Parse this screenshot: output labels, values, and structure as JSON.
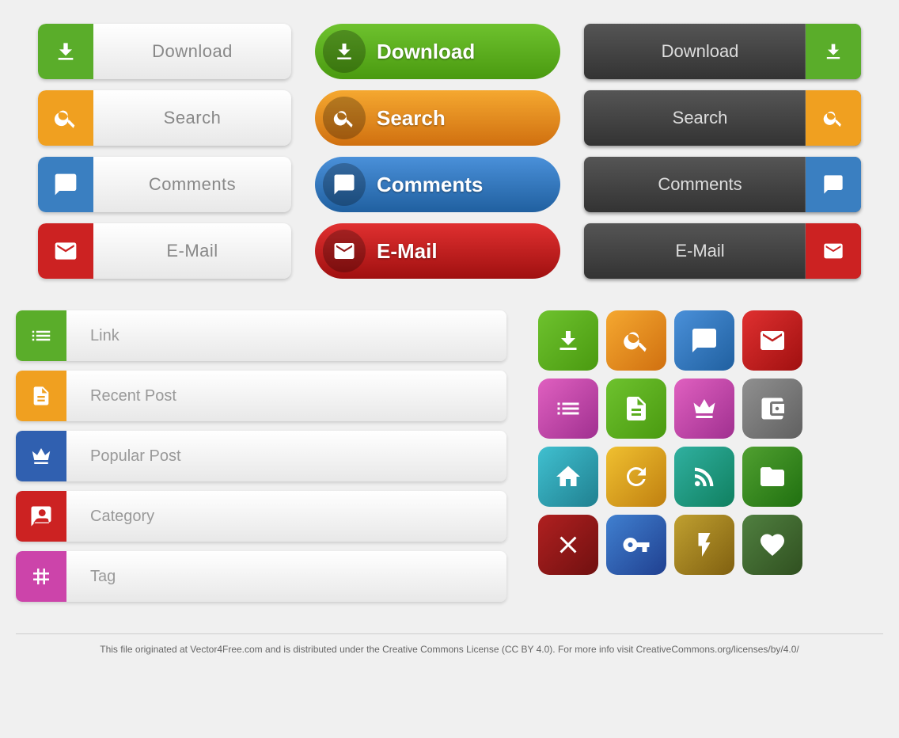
{
  "col1": {
    "buttons": [
      {
        "label": "Download",
        "color": "green",
        "icon": "download"
      },
      {
        "label": "Search",
        "color": "orange",
        "icon": "search"
      },
      {
        "label": "Comments",
        "color": "blue",
        "icon": "comment"
      },
      {
        "label": "E-Mail",
        "color": "red",
        "icon": "email"
      }
    ]
  },
  "col2": {
    "buttons": [
      {
        "label": "Download",
        "color": "green",
        "icon": "download"
      },
      {
        "label": "Search",
        "color": "orange",
        "icon": "search"
      },
      {
        "label": "Comments",
        "color": "blue",
        "icon": "comment"
      },
      {
        "label": "E-Mail",
        "color": "red",
        "icon": "email"
      }
    ]
  },
  "col3": {
    "buttons": [
      {
        "label": "Download",
        "color": "green",
        "icon": "download"
      },
      {
        "label": "Search",
        "color": "orange",
        "icon": "search"
      },
      {
        "label": "Comments",
        "color": "blue",
        "icon": "comment"
      },
      {
        "label": "E-Mail",
        "color": "red",
        "icon": "email"
      }
    ]
  },
  "list": {
    "items": [
      {
        "label": "Link",
        "color": "green",
        "icon": "list"
      },
      {
        "label": "Recent Post",
        "color": "orange",
        "icon": "doc"
      },
      {
        "label": "Popular Post",
        "color": "blue-royal",
        "icon": "crown"
      },
      {
        "label": "Category",
        "color": "red",
        "icon": "category"
      },
      {
        "label": "Tag",
        "color": "pink",
        "icon": "tag"
      }
    ]
  },
  "grid": {
    "icons": [
      {
        "name": "download",
        "color": "ic-green-d"
      },
      {
        "name": "search",
        "color": "ic-orange-s"
      },
      {
        "name": "comment",
        "color": "ic-blue-c"
      },
      {
        "name": "email",
        "color": "ic-red-m"
      },
      {
        "name": "list",
        "color": "ic-pink-l"
      },
      {
        "name": "doc",
        "color": "ic-green-l"
      },
      {
        "name": "crown",
        "color": "ic-pink-c"
      },
      {
        "name": "wallet",
        "color": "ic-gray"
      },
      {
        "name": "home",
        "color": "ic-cyan"
      },
      {
        "name": "refresh",
        "color": "ic-yellow"
      },
      {
        "name": "rss",
        "color": "ic-teal"
      },
      {
        "name": "folder",
        "color": "ic-green-f"
      },
      {
        "name": "close",
        "color": "ic-red-x"
      },
      {
        "name": "key",
        "color": "ic-blue-k"
      },
      {
        "name": "lightning",
        "color": "ic-olive"
      },
      {
        "name": "heart",
        "color": "ic-dark-g"
      }
    ]
  },
  "footer": {
    "text": "This file originated at Vector4Free.com and is distributed under the Creative Commons License (CC BY 4.0). For more info visit CreativeCommons.org/licenses/by/4.0/"
  }
}
